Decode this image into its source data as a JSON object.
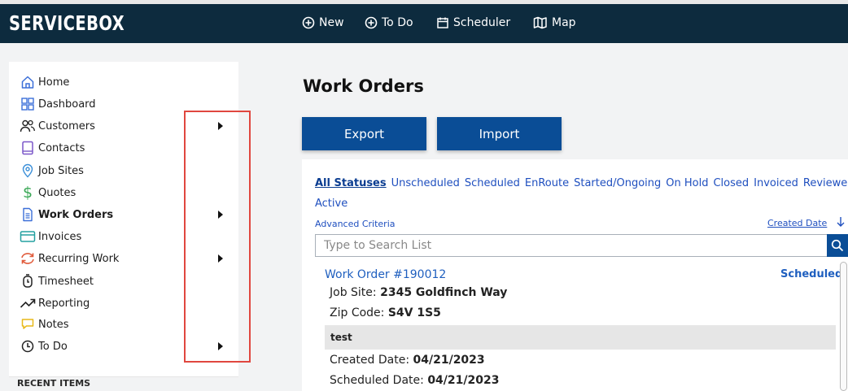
{
  "brand": "SERVICEBOX",
  "topnav": [
    {
      "label": "New",
      "icon": "plus-circle-icon"
    },
    {
      "label": "To Do",
      "icon": "plus-circle-icon"
    },
    {
      "label": "Scheduler",
      "icon": "calendar-icon"
    },
    {
      "label": "Map",
      "icon": "map-icon"
    }
  ],
  "sidebar": {
    "items": [
      {
        "label": "Home",
        "icon": "home-icon"
      },
      {
        "label": "Dashboard",
        "icon": "dashboard-icon"
      },
      {
        "label": "Customers",
        "icon": "users-icon",
        "has_submenu": true
      },
      {
        "label": "Contacts",
        "icon": "book-icon"
      },
      {
        "label": "Job Sites",
        "icon": "location-pin-icon"
      },
      {
        "label": "Quotes",
        "icon": "dollar-icon"
      },
      {
        "label": "Work Orders",
        "icon": "document-icon",
        "has_submenu": true,
        "active": true
      },
      {
        "label": "Invoices",
        "icon": "credit-card-icon"
      },
      {
        "label": "Recurring Work",
        "icon": "refresh-icon",
        "has_submenu": true
      },
      {
        "label": "Timesheet",
        "icon": "stopwatch-icon"
      },
      {
        "label": "Reporting",
        "icon": "trend-up-icon"
      },
      {
        "label": "Notes",
        "icon": "note-icon"
      },
      {
        "label": "To Do",
        "icon": "clock-icon",
        "has_submenu": true
      }
    ],
    "recent_heading": "RECENT ITEMS"
  },
  "main": {
    "title": "Work Orders",
    "export_label": "Export",
    "import_label": "Import",
    "statuses": [
      "All Statuses",
      "Unscheduled",
      "Scheduled",
      "EnRoute",
      "Started/Ongoing",
      "On Hold",
      "Closed",
      "Invoiced",
      "Reviewed"
    ],
    "status_active": "Active",
    "advanced_criteria": "Advanced Criteria",
    "sort_label": "Created Date",
    "search_placeholder": "Type to Search List"
  },
  "work_order": {
    "title": "Work Order #190012",
    "status": "Scheduled",
    "job_site_label": "Job Site:",
    "job_site": "2345 Goldfinch Way",
    "zip_label": "Zip Code:",
    "zip": "S4V 1S5",
    "note": "test",
    "created_label": "Created Date:",
    "created": "04/21/2023",
    "scheduled_label": "Scheduled Date:",
    "scheduled": "04/21/2023"
  },
  "colors": {
    "topbar": "#0d2b3e",
    "primary_button": "#0a4d96",
    "link": "#1f4fbf",
    "highlight_box": "#e0473f"
  }
}
